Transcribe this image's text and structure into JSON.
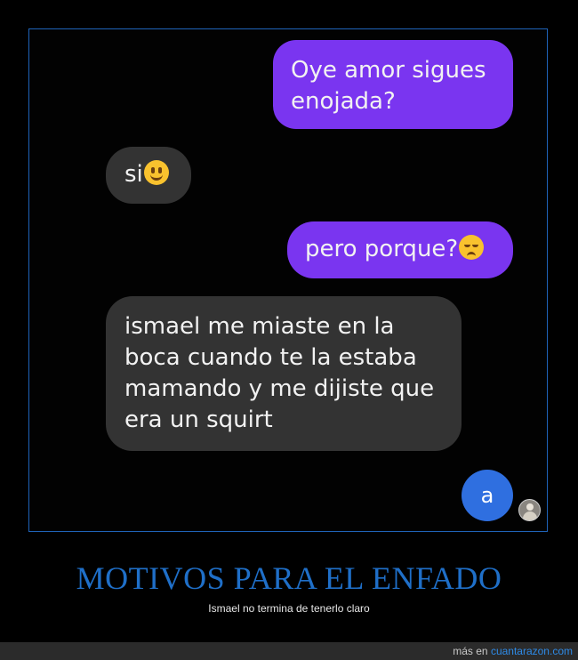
{
  "conversation": {
    "messages": [
      {
        "side": "sent",
        "text": "Oye amor sigues enojada?"
      },
      {
        "side": "received",
        "text": "si",
        "emoji": "slightly-smiling-face-icon"
      },
      {
        "side": "sent",
        "text": "pero porque?",
        "emoji": "disappointed-face-icon"
      },
      {
        "side": "received",
        "text": "ismael me miaste en la boca cuando te la estaba mamando y me dijiste que era un squirt"
      }
    ],
    "typing_bubble_text": "a",
    "colors": {
      "sent_bubble": "#7a35f0",
      "received_bubble": "#333333",
      "input_bubble": "#2f6fe0",
      "frame_border": "#1f63b8"
    }
  },
  "caption": {
    "title": "MOTIVOS PARA EL ENFADO",
    "subtitle": "Ismael no termina de tenerlo claro",
    "title_color": "#1f6fc8"
  },
  "footer": {
    "prefix": "más en ",
    "site": "cuantarazon.com",
    "link_color": "#2e8ae6"
  }
}
